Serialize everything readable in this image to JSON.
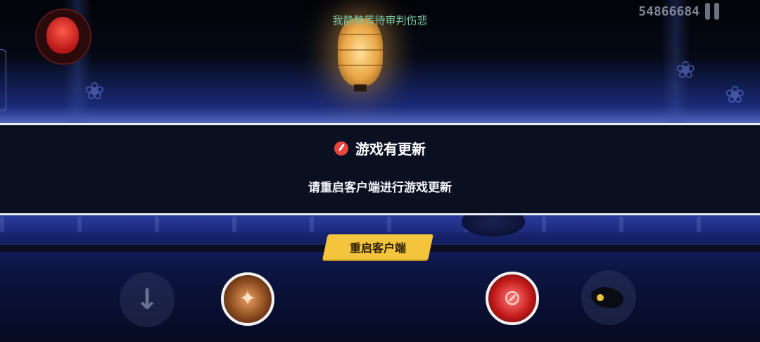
{
  "hud": {
    "caption": "我静静等待审判伤悲",
    "score": "54866684"
  },
  "dialog": {
    "title": "游戏有更新",
    "message": "请重启客户端进行游戏更新",
    "button_label": "重启客户端"
  },
  "icons": {
    "warning": "warning-icon",
    "pause": "pause-icon",
    "avatar": "ninja-mask-icon",
    "down": "down-arrow-icon",
    "fire_skill": "fire-skill-icon",
    "slash_skill": "red-slash-skill-icon",
    "dash": "dash-icon"
  },
  "colors": {
    "caption": "#79c7a6",
    "button": "#f4c43c",
    "warning": "#e8453c",
    "panel": "#0b1021"
  }
}
